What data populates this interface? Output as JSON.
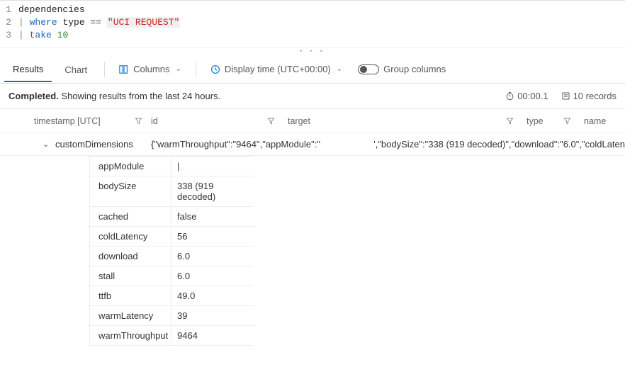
{
  "editor": {
    "lines": [
      {
        "n": "1",
        "table": "dependencies"
      },
      {
        "n": "2",
        "kw": "where",
        "field": "type",
        "op": "==",
        "str": "\"UCI REQUEST\""
      },
      {
        "n": "3",
        "kw": "take",
        "num": "10"
      }
    ]
  },
  "tabs": {
    "results": "Results",
    "chart": "Chart"
  },
  "toolbar": {
    "columns": "Columns",
    "display_time": "Display time (UTC+00:00)",
    "group_columns": "Group columns"
  },
  "status": {
    "completed": "Completed.",
    "subtitle": " Showing results from the last 24 hours.",
    "elapsed": "00:00.1",
    "records": "10 records"
  },
  "columns": {
    "timestamp": "timestamp [UTC]",
    "id": "id",
    "target": "target",
    "type": "type",
    "name": "name"
  },
  "row": {
    "key": "customDimensions",
    "val_left": "{\"warmThroughput\":\"9464\",\"appModule\":\"",
    "val_right": "',\"bodySize\":\"338 (919 decoded)\",\"download\":\"6.0\",\"coldLaten"
  },
  "dims": [
    {
      "k": "appModule",
      "v": "|"
    },
    {
      "k": "bodySize",
      "v": "338 (919 decoded)"
    },
    {
      "k": "cached",
      "v": "false"
    },
    {
      "k": "coldLatency",
      "v": "56"
    },
    {
      "k": "download",
      "v": "6.0"
    },
    {
      "k": "stall",
      "v": "6.0"
    },
    {
      "k": "ttfb",
      "v": "49.0"
    },
    {
      "k": "warmLatency",
      "v": "39"
    },
    {
      "k": "warmThroughput",
      "v": "9464"
    }
  ]
}
